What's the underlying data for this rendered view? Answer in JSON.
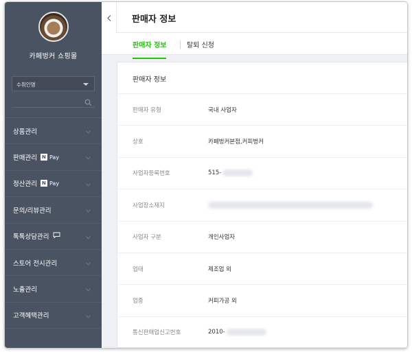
{
  "sidebar": {
    "brand_name": "카페벙커 쇼핑몰",
    "store_select": "수취인명",
    "items": [
      {
        "label": "상품관리"
      },
      {
        "label": "판매관리",
        "badge": "Pay"
      },
      {
        "label": "정산관리",
        "badge": "Pay"
      },
      {
        "label": "문의/리뷰관리"
      },
      {
        "label": "톡톡상담관리"
      },
      {
        "label": "스토어 전시관리"
      },
      {
        "label": "노출관리"
      },
      {
        "label": "고객혜택관리"
      }
    ]
  },
  "header": {
    "title": "판매자 정보"
  },
  "tabs": [
    {
      "label": "판매자 정보",
      "active": true
    },
    {
      "label": "탈퇴 신청",
      "active": false
    }
  ],
  "card": {
    "title": "판매자 정보",
    "rows": [
      {
        "label": "판매자 유형",
        "value": "국내 사업자"
      },
      {
        "label": "상호",
        "value": "카페벙커본점,커피벙커"
      },
      {
        "label": "사업자등록번호",
        "value": "515-"
      },
      {
        "label": "사업장소재지",
        "value": ""
      },
      {
        "label": "사업자 구분",
        "value": "개인사업자"
      },
      {
        "label": "업태",
        "value": "제조업 외"
      },
      {
        "label": "업종",
        "value": "커피가공 외"
      },
      {
        "label": "통신판매업신고번호",
        "value": "2010-"
      }
    ]
  },
  "colors": {
    "sidebar_bg": "#4a5361",
    "accent_green": "#1ec800"
  }
}
